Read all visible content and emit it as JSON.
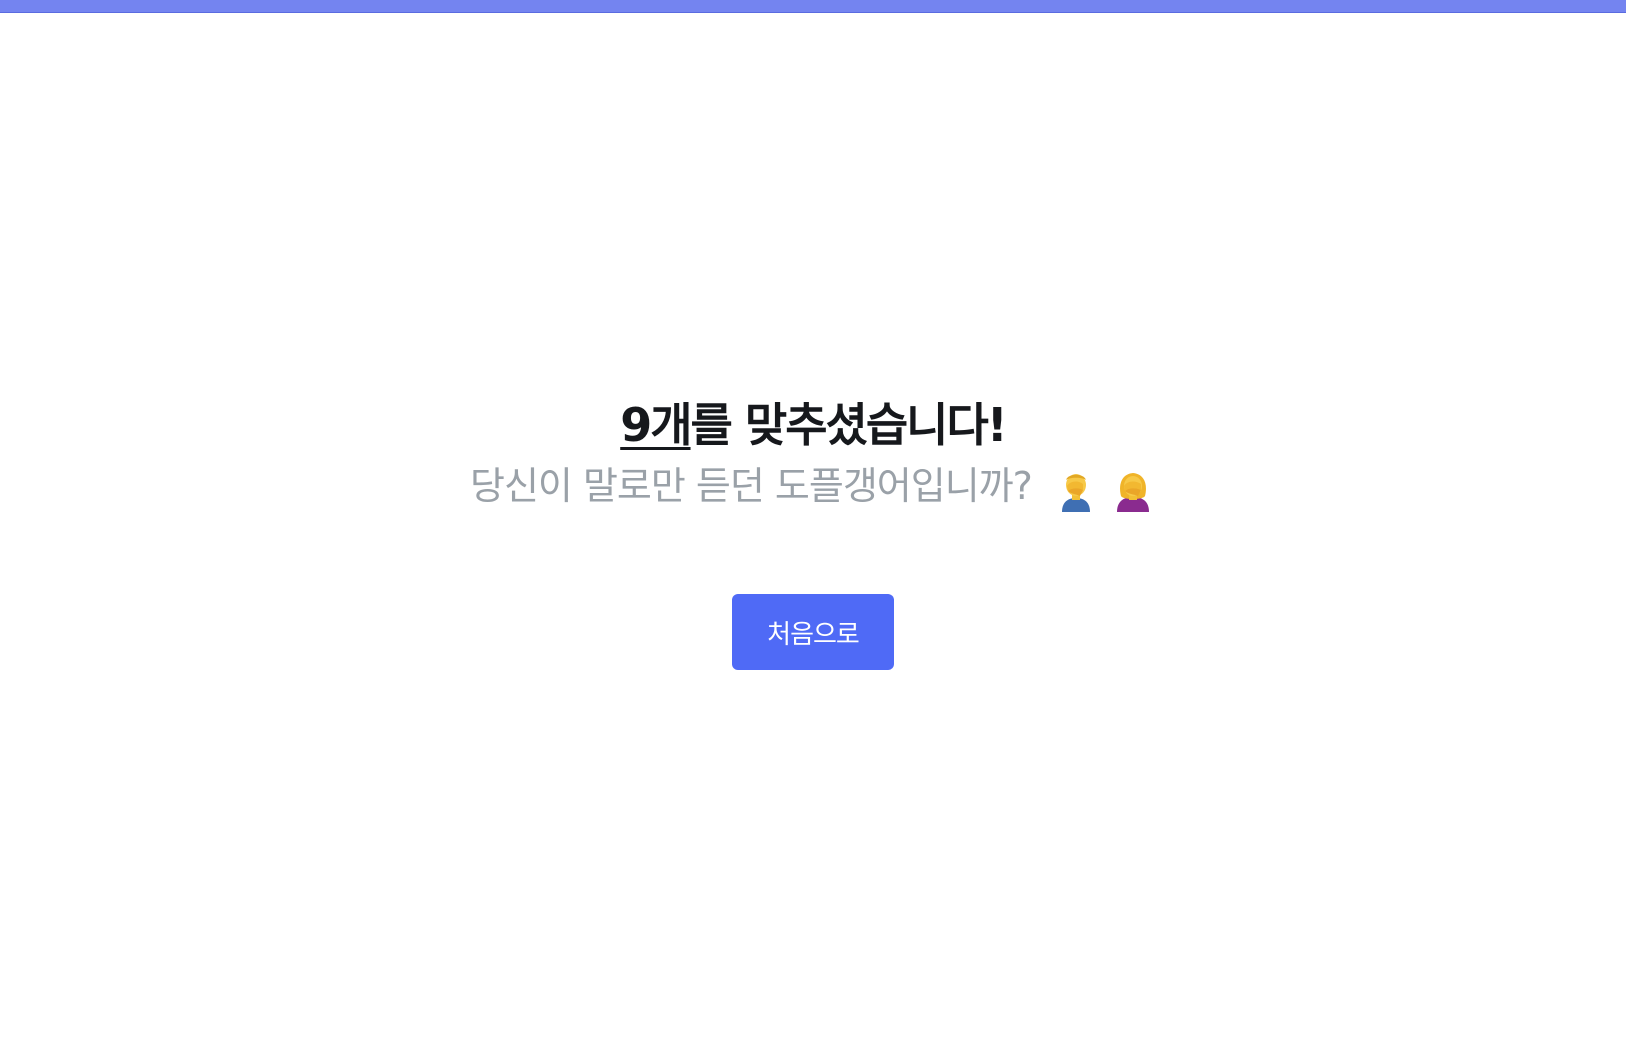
{
  "result": {
    "score": "9개",
    "title_rest": "를 맞추셨습니다!",
    "subtitle": "당신이 말로만 듣던 도플갱어입니까?",
    "emojis": [
      "man-facepalming-emoji",
      "woman-facepalming-emoji"
    ]
  },
  "actions": {
    "restart_label": "처음으로"
  },
  "colors": {
    "accent": "#4f6af6",
    "top_bar": "#7484f0",
    "title": "#16181c",
    "subtitle": "#9aa1a8"
  }
}
